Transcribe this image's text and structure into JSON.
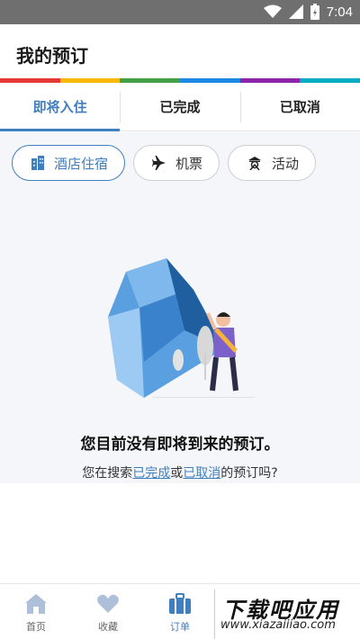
{
  "status_bar": {
    "time": "7:04",
    "icons": [
      "wifi-icon",
      "signal-icon",
      "battery-icon"
    ]
  },
  "header": {
    "title": "我的预订"
  },
  "accent_colors": [
    "#e53935",
    "#f6b800",
    "#43a047",
    "#1e88e5",
    "#8e24aa",
    "#00acc1"
  ],
  "tabs": [
    {
      "label": "即将入住",
      "active": true
    },
    {
      "label": "已完成",
      "active": false
    },
    {
      "label": "已取消",
      "active": false
    }
  ],
  "filters": [
    {
      "label": "酒店住宿",
      "icon": "hotel-icon",
      "active": true
    },
    {
      "label": "机票",
      "icon": "plane-icon",
      "active": false
    },
    {
      "label": "活动",
      "icon": "activity-icon",
      "active": false
    }
  ],
  "empty_state": {
    "title": "您目前没有即将到来的预订。",
    "prefix": "您在搜索",
    "link_completed": "已完成",
    "or": "或",
    "link_cancelled": "已取消",
    "suffix": "的预订吗?"
  },
  "bottom_nav": [
    {
      "label": "首页",
      "icon": "home-icon",
      "active": false
    },
    {
      "label": "收藏",
      "icon": "heart-icon",
      "active": false
    },
    {
      "label": "订单",
      "icon": "suitcase-icon",
      "active": true
    }
  ],
  "watermark": {
    "brand": "下载吧应用",
    "url": "www.xiazaiiiao.com"
  },
  "primary_color": "#3f7fc0"
}
